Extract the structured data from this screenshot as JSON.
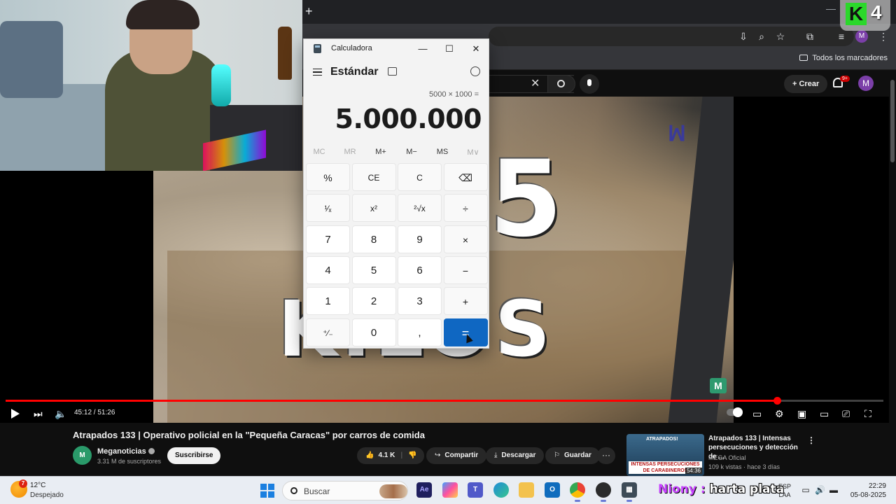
{
  "browser": {
    "new_tab_symbol": "+",
    "minimize_symbol": "—",
    "bookmarks_all": "Todos los marcadores",
    "profile_initial": "M"
  },
  "youtube": {
    "create_label": "Crear",
    "notif_badge": "9+",
    "avatar_initial": "M",
    "search_clear": "✕"
  },
  "video": {
    "overlay_number": "5",
    "overlay_word": "KILOS",
    "current_time": "45:12",
    "duration": "51:26",
    "time_display": "45:12 / 51:26",
    "progress_fraction": 0.879,
    "title": "Atrapados 133 | Operativo policial en la \"Pequeña Caracas\" por carros de comida"
  },
  "channel": {
    "name": "Meganoticias",
    "subscribers": "3.31 M de suscriptores",
    "subscribe_label": "Suscribirse",
    "avatar_text": "M"
  },
  "actions": {
    "likes": "4.1 K",
    "share": "Compartir",
    "download": "Descargar",
    "save": "Guardar",
    "more": "···"
  },
  "recommended": {
    "title": "Atrapados 133 | Intensas persecuciones y detección de ...",
    "channel": "MEGA Oficial",
    "meta": "109 k vistas · hace 3 días",
    "duration": "54:36",
    "thumb_label": "INTENSAS PERSECUCIONES DE CARABINEROS",
    "thumb_brand": "ATRAPADOS!"
  },
  "calculator": {
    "app_title": "Calculadora",
    "mode": "Estándar",
    "expression": "5000 × 1000 =",
    "result": "5.000.000",
    "memory": [
      {
        "label": "MC",
        "enabled": false
      },
      {
        "label": "MR",
        "enabled": false
      },
      {
        "label": "M+",
        "enabled": true
      },
      {
        "label": "M−",
        "enabled": true
      },
      {
        "label": "MS",
        "enabled": true
      },
      {
        "label": "M∨",
        "enabled": false
      }
    ],
    "keys": [
      [
        "%",
        "CE",
        "C",
        "⌫"
      ],
      [
        "¹⁄ₓ",
        "x²",
        "²√x",
        "÷"
      ],
      [
        "7",
        "8",
        "9",
        "×"
      ],
      [
        "4",
        "5",
        "6",
        "−"
      ],
      [
        "1",
        "2",
        "3",
        "+"
      ],
      [
        "⁺⁄₋",
        "0",
        ",",
        "="
      ]
    ]
  },
  "streamer": {
    "badge_letter": "K",
    "badge_number": "4"
  },
  "taskbar": {
    "temperature": "12°C",
    "condition": "Despejado",
    "weather_alert": "7",
    "search_placeholder": "Buscar",
    "chat_user": "Niony :",
    "chat_message": "harta plata",
    "language": "ESP",
    "layout": "LAA",
    "time": "22:29",
    "date": "05-08-2025",
    "apps": [
      "start",
      "search",
      "after-effects",
      "copilot",
      "teams",
      "edge",
      "file-explorer",
      "outlook",
      "chrome",
      "obs",
      "calculator"
    ]
  },
  "colors": {
    "yt_red": "#ff0000",
    "calc_equals": "#0f67c2",
    "chat_name": "#c844ff",
    "k_green": "#2bd82b"
  }
}
